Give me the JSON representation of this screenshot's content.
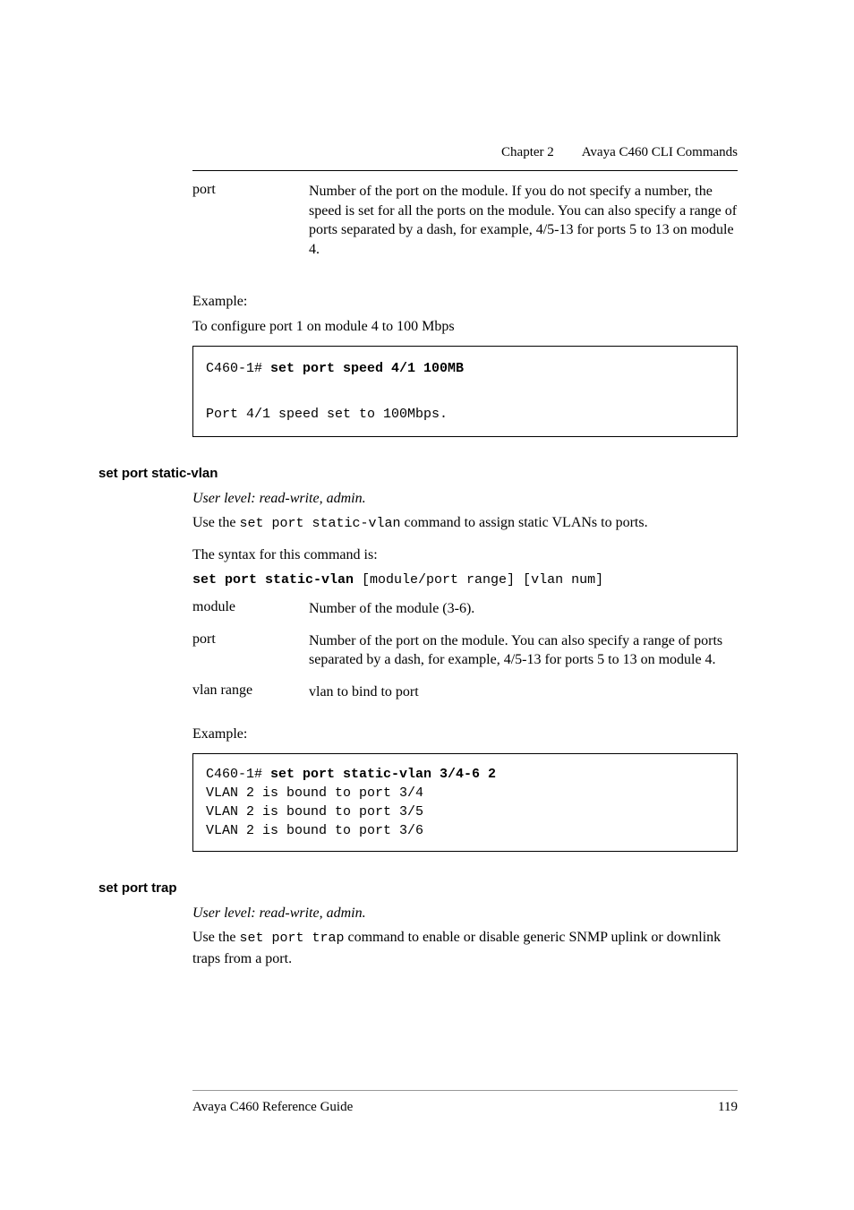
{
  "header": {
    "chapter_label": "Chapter 2",
    "chapter_title": "Avaya C460 CLI Commands"
  },
  "top_def": {
    "port_key": "port",
    "port_val": "Number of the port on the module. If you do not specify a number, the speed is set for all the ports on the module. You can also specify a range of ports separated by a dash, for example, 4/5-13 for ports 5 to 13 on module 4."
  },
  "example1": {
    "label": "Example:",
    "desc": "To configure port 1 on module 4 to 100 Mbps",
    "cmd_prefix": "C460-1# ",
    "cmd_bold": "set port speed 4/1 100MB",
    "output": "Port 4/1 speed set to 100Mbps."
  },
  "section_staticvlan": {
    "heading": "set port static-vlan",
    "userlevel": "User level: read-write, admin.",
    "use_pre": "Use the ",
    "use_code": "set port static-vlan",
    "use_post": " command to assign static VLANs to ports.",
    "syntax_label": "The syntax for this command is:",
    "syntax_bold": "set port static-vlan",
    "syntax_rest": " [module/port range] [vlan num]",
    "def": {
      "module_key": "module",
      "module_val": "Number of the module (3-6).",
      "port_key": "port",
      "port_val": "Number of the port on the module.\nYou can also specify a range of ports separated by a dash, for example, 4/5-13 for ports 5 to 13 on module 4.",
      "vlanrange_key": "vlan range",
      "vlanrange_val": "vlan to bind to port"
    },
    "example_label": "Example:",
    "example_prefix": "C460-1# ",
    "example_bold": "set port static-vlan 3/4-6 2",
    "example_out1": "VLAN 2 is bound to port 3/4",
    "example_out2": "VLAN 2 is bound to port 3/5",
    "example_out3": "VLAN 2 is bound to port 3/6"
  },
  "section_trap": {
    "heading": "set port trap",
    "userlevel": "User level: read-write, admin.",
    "use_pre": "Use the ",
    "use_code": "set port trap",
    "use_post": " command to enable or disable generic SNMP uplink or downlink traps from a port."
  },
  "footer": {
    "left": "Avaya C460 Reference Guide",
    "right": "119"
  }
}
